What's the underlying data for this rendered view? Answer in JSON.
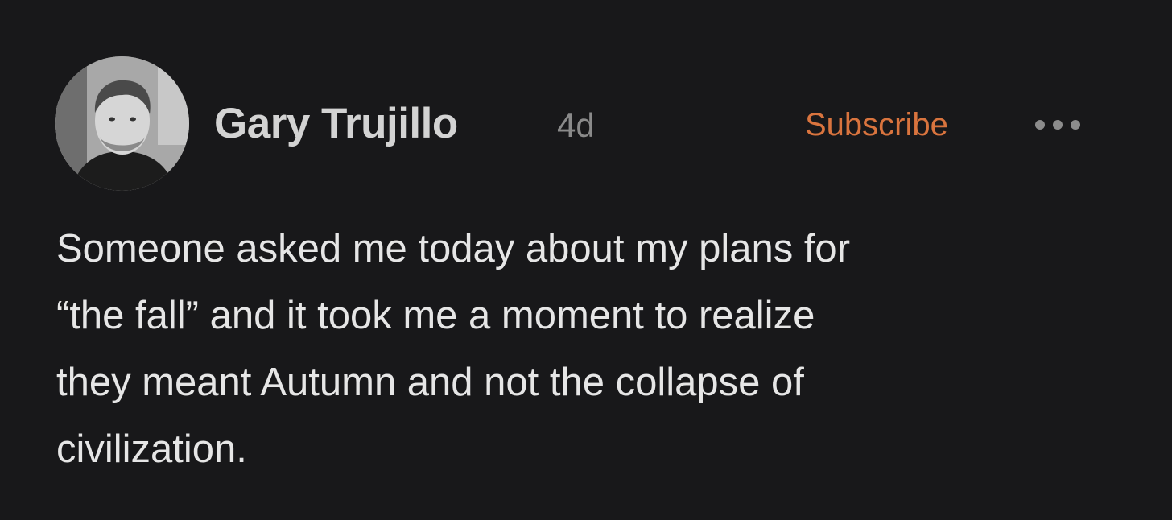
{
  "post": {
    "author": {
      "name": "Gary Trujillo",
      "avatar_icon": "user-photo"
    },
    "age": "4d",
    "subscribe_label": "Subscribe",
    "more_icon": "ellipsis-horizontal-icon",
    "text": "Someone asked me today about my plans for\n“the fall” and it took me a moment to realize\nthey meant Autumn and not the collapse of\ncivilization."
  },
  "colors": {
    "background": "#18181a",
    "name": "#d3d3d3",
    "muted": "#8a8a8a",
    "accent": "#d9743e",
    "body": "#e6e6e6"
  }
}
